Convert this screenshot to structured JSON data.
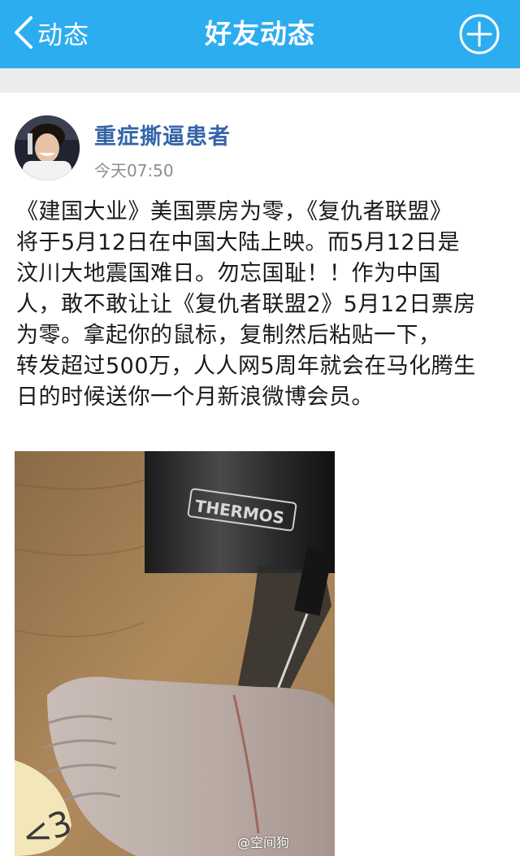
{
  "colors": {
    "nav_bg": "#2cadf0",
    "username": "#3565a8",
    "timestamp": "#8e8e8e",
    "body_text": "#1a1a1a",
    "page_bg": "#ececec"
  },
  "nav": {
    "back_label": "动态",
    "title": "好友动态",
    "back_icon": "chevron-left-icon",
    "add_icon": "plus-circle-icon"
  },
  "post": {
    "author": "重症撕逼患者",
    "time": "今天07:50",
    "text": "《建国大业》美国票房为零，《复仇者联盟》\n将于5月12日在中国大陆上映。而5月12日是\n汶川大地震国难日。勿忘国耻！！作为中国\n人，敢不敢让让《复仇者联盟2》5月12日票房\n为零。拿起你的鼠标，复制然后粘贴一下，\n转发超过500万，人人网5周年就会在马化腾生\n日的时候送你一个月新浪微博会员。",
    "photo": {
      "cup_label": "THERMOS",
      "watermark": "@空间狗"
    }
  }
}
